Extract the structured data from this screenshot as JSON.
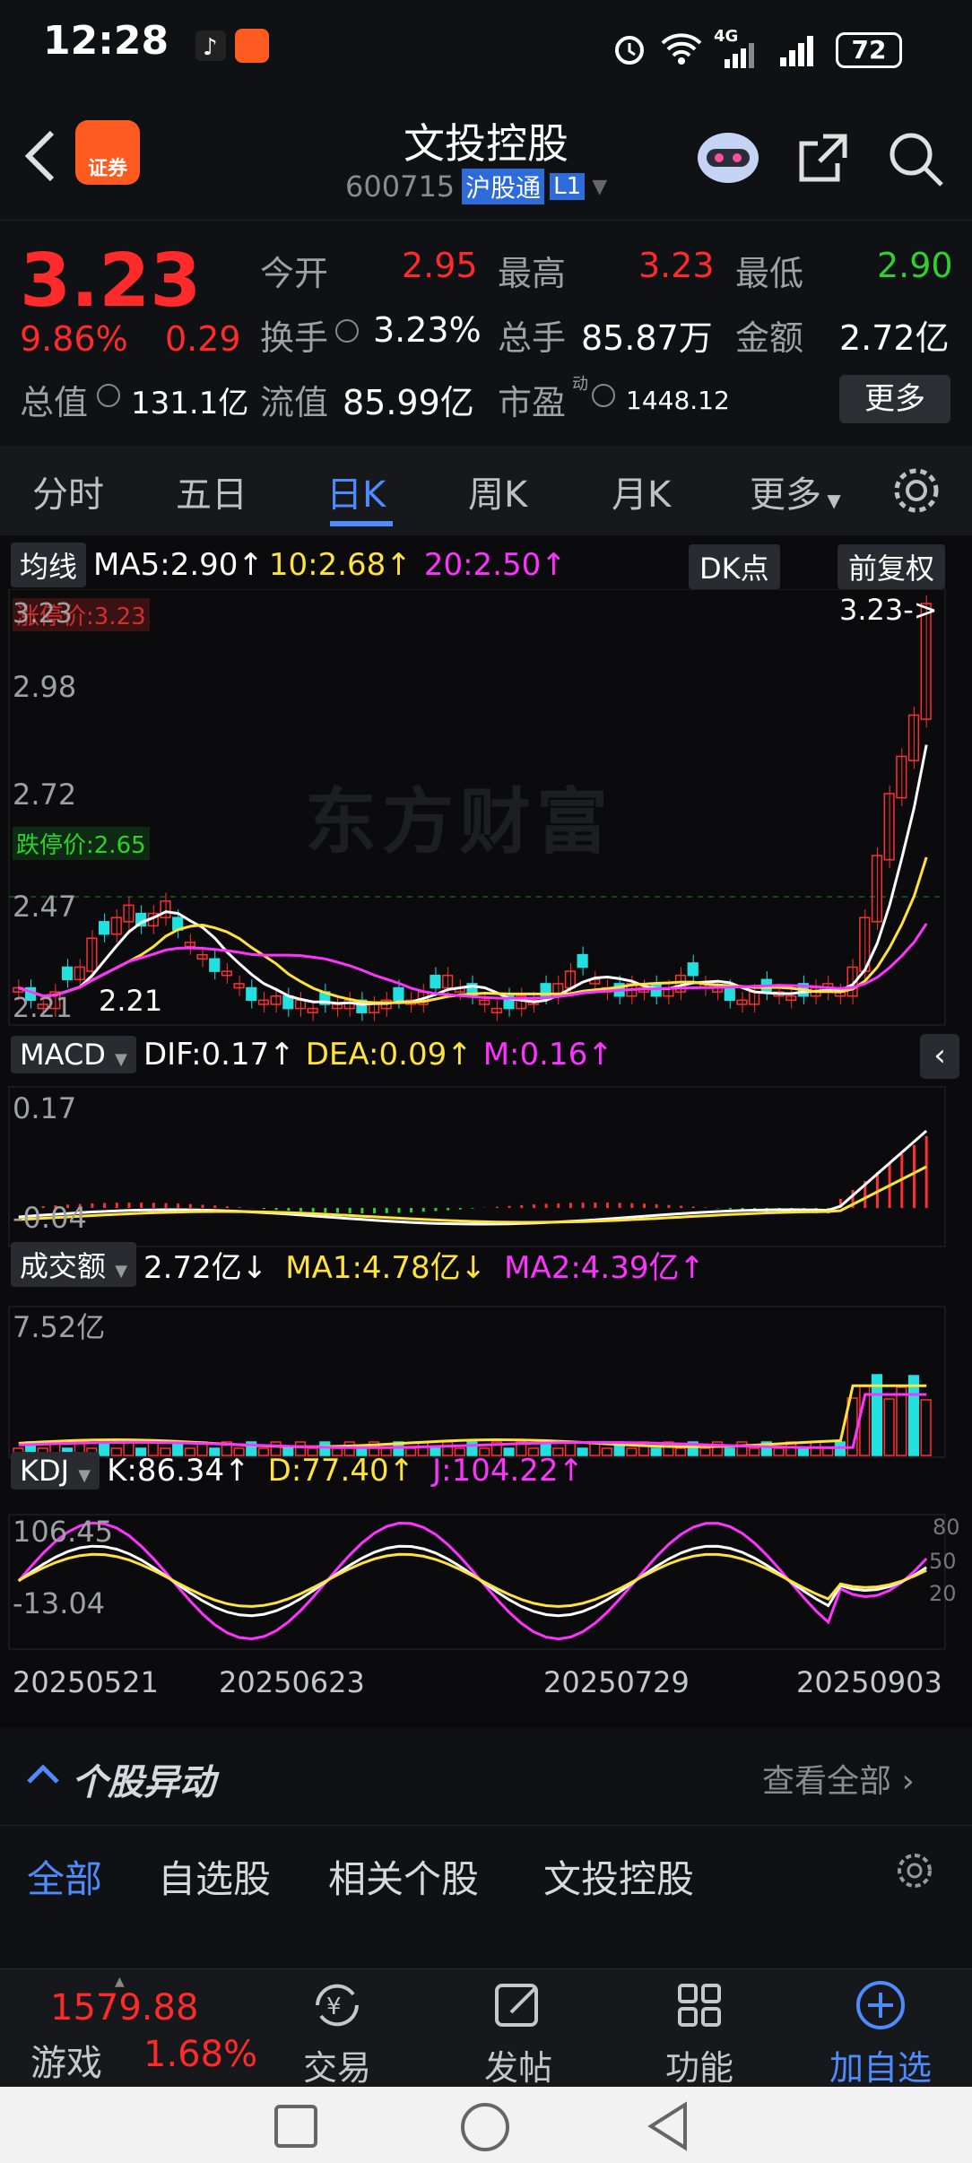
{
  "status": {
    "time": "12:28",
    "battery": "72",
    "network": "4G"
  },
  "header": {
    "title": "文投控股",
    "code": "600715",
    "connect": "沪股通",
    "level": "L1",
    "broker_badge": "证券"
  },
  "quote": {
    "price": "3.23",
    "pct": "9.86%",
    "change": "0.29",
    "open_label": "今开",
    "open": "2.95",
    "high_label": "最高",
    "high": "3.23",
    "low_label": "最低",
    "low": "2.90",
    "turnover_label": "换手",
    "turnover": "3.23%",
    "vol_label": "总手",
    "vol": "85.87万",
    "amount_label": "金额",
    "amount": "2.72亿",
    "mcap_label": "总值",
    "mcap": "131.1亿",
    "float_label": "流值",
    "float": "85.99亿",
    "pe_label": "市盈",
    "pe_sup": "动",
    "pe": "1448.12",
    "more": "更多"
  },
  "tabs": [
    "分时",
    "五日",
    "日K",
    "周K",
    "月K",
    "更多"
  ],
  "active_tab": "日K",
  "kline": {
    "ma_btn": "均线",
    "ma5": "MA5:2.90↑",
    "ma10": "10:2.68↑",
    "ma20": "20:2.50↑",
    "dk": "DK点",
    "fq": "前复权",
    "limit_up": "涨停价:3.23",
    "limit_down": "跌停价:2.65",
    "y_labels": [
      "3.23",
      "2.98",
      "2.72",
      "2.47",
      "2.21"
    ],
    "last_marker": "3.23->",
    "min_label": "2.21"
  },
  "macd": {
    "btn": "MACD",
    "dif": "DIF:0.17↑",
    "dea": "DEA:0.09↑",
    "m": "M:0.16↑",
    "ytop": "0.17",
    "ybot": "-0.04"
  },
  "volume": {
    "btn": "成交额",
    "val": "2.72亿↓",
    "ma1": "MA1:4.78亿↓",
    "ma2": "MA2:4.39亿↑",
    "ytop": "7.52亿"
  },
  "kdj": {
    "btn": "KDJ",
    "k": "K:86.34↑",
    "d": "D:77.40↑",
    "j": "J:104.22↑",
    "ytop": "106.45",
    "ybot": "-13.04",
    "levels": [
      "80",
      "50",
      "20"
    ]
  },
  "dates": [
    "20250521",
    "20250623",
    "20250729",
    "20250903"
  ],
  "watermark": "东方财富",
  "yidong": {
    "title": "个股异动",
    "all": "查看全部"
  },
  "filter": [
    "全部",
    "自选股",
    "相关个股",
    "文投控股"
  ],
  "bottom": {
    "index_val": "1579.88",
    "index_name": "游戏",
    "index_pct": "1.68%",
    "trade": "交易",
    "post": "发帖",
    "func": "功能",
    "add": "加自选"
  },
  "chart_data": {
    "type": "candlestick",
    "current": 3.23,
    "ylim": [
      2.21,
      3.23
    ]
  }
}
